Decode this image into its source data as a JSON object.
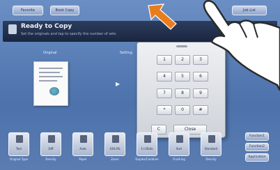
{
  "header": {
    "tab_left": "Favorite",
    "tab_middle": "Book Copy",
    "tab_right": "Job List"
  },
  "status": {
    "title": "Ready to Copy",
    "subtitle": "Set the originals and tap to specify the number of sets"
  },
  "preview": {
    "original_label": "Original",
    "set_label": "Setting"
  },
  "keypad": {
    "keys": [
      "1",
      "2",
      "3",
      "4",
      "5",
      "6",
      "7",
      "8",
      "9",
      "*",
      "0",
      "#"
    ],
    "clear_label": "C",
    "close_label": "Close"
  },
  "functions": [
    {
      "value": "Text",
      "caption": "Original Type"
    },
    {
      "value": "Diff",
      "caption": "Density"
    },
    {
      "value": "Auto",
      "caption": "Paper"
    },
    {
      "value": "100.0%",
      "caption": "Zoom"
    },
    {
      "value": "1>2Side",
      "caption": "Duplex/Combine"
    },
    {
      "value": "Sort",
      "caption": "Finishing"
    },
    {
      "value": "Standard",
      "caption": "Density"
    }
  ],
  "right_buttons": [
    "Function1",
    "Function2",
    "Application"
  ],
  "colors": {
    "swipe_arrow": "#e87d1e",
    "panel_bg": "#5b7fb5"
  }
}
